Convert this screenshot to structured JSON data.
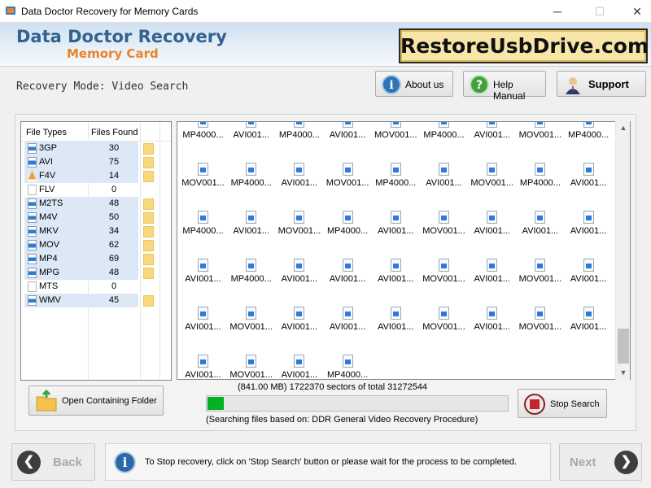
{
  "window": {
    "title": "Data Doctor Recovery for Memory Cards",
    "minimize": "─",
    "maximize": "☐",
    "close": "✕"
  },
  "header": {
    "brand_line1": "Data Doctor Recovery",
    "brand_line2": "Memory Card",
    "site_banner": "RestoreUsbDrive.com"
  },
  "mode_label": "Recovery Mode: Video Search",
  "toolbar": {
    "about_label": "About us",
    "help_label": "Help Manual",
    "support_label": "Support"
  },
  "file_types": {
    "col_type": "File Types",
    "col_found": "Files Found",
    "rows": [
      {
        "type": "3GP",
        "count": "30",
        "highlight": true
      },
      {
        "type": "AVI",
        "count": "75",
        "highlight": true
      },
      {
        "type": "F4V",
        "count": "14",
        "highlight": true
      },
      {
        "type": "FLV",
        "count": "0",
        "highlight": false
      },
      {
        "type": "M2TS",
        "count": "48",
        "highlight": true
      },
      {
        "type": "M4V",
        "count": "50",
        "highlight": true
      },
      {
        "type": "MKV",
        "count": "34",
        "highlight": true
      },
      {
        "type": "MOV",
        "count": "62",
        "highlight": true
      },
      {
        "type": "MP4",
        "count": "69",
        "highlight": true
      },
      {
        "type": "MPG",
        "count": "48",
        "highlight": true
      },
      {
        "type": "MTS",
        "count": "0",
        "highlight": false
      },
      {
        "type": "WMV",
        "count": "45",
        "highlight": true
      }
    ]
  },
  "results": {
    "rows": [
      [
        "MP4000...",
        "AVI001...",
        "MP4000...",
        "AVI001...",
        "MOV001...",
        "MP4000...",
        "AVI001...",
        "MOV001...",
        "MP4000..."
      ],
      [
        "MOV001...",
        "MP4000...",
        "AVI001...",
        "MOV001...",
        "MP4000...",
        "AVI001...",
        "MOV001...",
        "MP4000...",
        "AVI001..."
      ],
      [
        "MP4000...",
        "AVI001...",
        "MOV001...",
        "MP4000...",
        "AVI001...",
        "MOV001...",
        "AVI001...",
        "AVI001...",
        "AVI001..."
      ],
      [
        "AVI001...",
        "MP4000...",
        "AVI001...",
        "AVI001...",
        "AVI001...",
        "MOV001...",
        "AVI001...",
        "MOV001...",
        "AVI001..."
      ],
      [
        "AVI001...",
        "MOV001...",
        "AVI001...",
        "AVI001...",
        "AVI001...",
        "MOV001...",
        "AVI001...",
        "MOV001...",
        "AVI001..."
      ],
      [
        "AVI001...",
        "MOV001...",
        "AVI001...",
        "MP4000..."
      ]
    ],
    "scroll_up": "▲",
    "scroll_down": "▼"
  },
  "actions": {
    "open_folder_label": "Open Containing Folder",
    "stop_label": "Stop Search"
  },
  "progress": {
    "size": "(841.00 MB)",
    "sectors": "1722370",
    "sectors_label": "sectors",
    "of_total_label": "of  total",
    "total": "31272544",
    "fraction": 0.055,
    "method": "(Searching files based on:  DDR General Video Recovery Procedure)"
  },
  "bottom": {
    "back_label": "Back",
    "next_label": "Next",
    "back_glyph": "❮",
    "next_glyph": "❯",
    "info_text": "To Stop recovery, click on 'Stop Search' button or please wait for the process to be completed."
  },
  "colors": {
    "brand_blue": "#35618f",
    "brand_orange": "#e8832a",
    "progress_green": "#06b025",
    "highlight": "#dce8f5"
  }
}
